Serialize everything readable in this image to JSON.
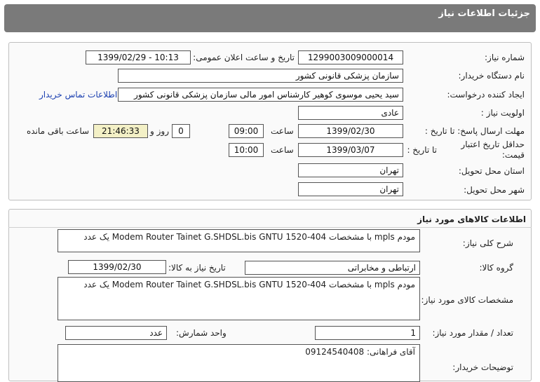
{
  "header": {
    "title": "جزئیات اطلاعات نیاز"
  },
  "info": {
    "need_number_label": "شماره نیاز:",
    "need_number": "1299003009000014",
    "announce_label": "تاریخ و ساعت اعلان عمومی:",
    "announce_value": "1399/02/29 - 10:13",
    "buyer_org_label": "نام دستگاه خریدار:",
    "buyer_org": "سازمان پزشکی قانونی کشور",
    "creator_label": "ایجاد کننده درخواست:",
    "creator": "سید یحیی موسوی کوهیر کارشناس امور مالی سازمان پزشکی قانونی کشور",
    "contact_link": "اطلاعات تماس خریدار",
    "priority_label": "اولویت نیاز :",
    "priority": "عادی",
    "reply_deadline_label": "مهلت ارسال پاسخ: تا تاریخ :",
    "reply_date": "1399/02/30",
    "time_label": "ساعت",
    "reply_time": "09:00",
    "days": "0",
    "days_label": "روز و",
    "remaining_time": "21:46:33",
    "remaining_label": "ساعت باقی مانده",
    "price_validity_label_1": "حداقل تاریخ اعتبار",
    "price_validity_label_2": "قیمت:",
    "until_date_label": "تا تاریخ :",
    "validity_date": "1399/03/07",
    "validity_time": "10:00",
    "province_label": "استان محل تحویل:",
    "province": "تهران",
    "city_label": "شهر محل تحویل:",
    "city": "تهران"
  },
  "goods": {
    "section_title": "اطلاعات کالاهای مورد نیاز",
    "general_desc_label": "شرح کلی نیاز:",
    "general_desc": "مودم mpls با مشخصات  Modem Router Tainet G.SHDSL.bis GNTU 1520-404      یک عدد",
    "group_label": "گروه کالا:",
    "group": "ارتباطی و مخابراتی",
    "need_date_label": "تاریخ نیاز به کالا:",
    "need_date": "1399/02/30",
    "specs_label": "مشخصات کالای مورد نیاز:",
    "specs": "مودم mpls با مشخصات  Modem Router Tainet G.SHDSL.bis GNTU 1520-404      یک عدد",
    "quantity_label": "تعداد / مقدار مورد نیاز:",
    "quantity": "1",
    "unit_label": "واحد شمارش:",
    "unit": "عدد",
    "buyer_notes_label": "توضیحات خریدار:",
    "buyer_notes": "آقای فراهانی: 09124540408"
  }
}
